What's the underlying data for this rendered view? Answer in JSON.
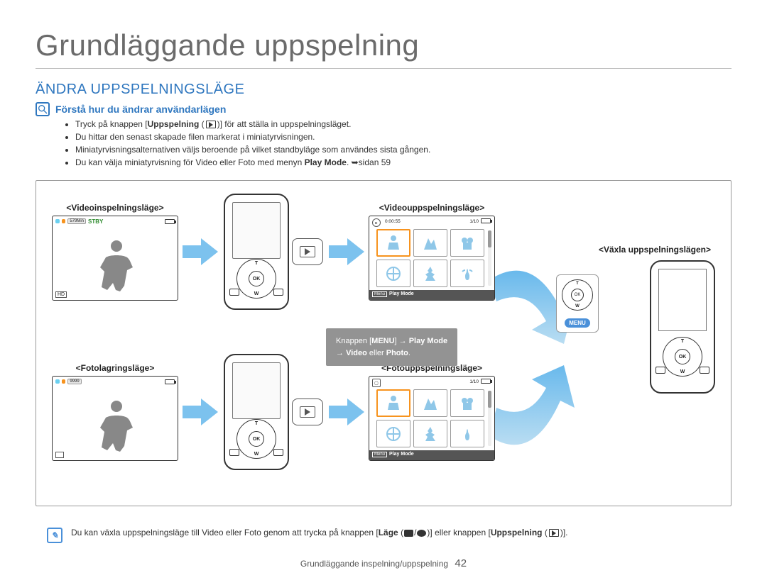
{
  "page": {
    "title": "Grundläggande uppspelning",
    "section": "ÄNDRA UPPSPELNINGSLÄGE",
    "sub_title": "Förstå hur du ändrar användarlägen",
    "bullets": [
      {
        "pre": "Tryck på knappen [",
        "bold1": "Uppspelning",
        "mid": " (",
        "icon": "play",
        "post": ")] för att ställa in uppspelningsläget."
      },
      {
        "text": "Du hittar den senast skapade filen markerat i miniatyrvisningen."
      },
      {
        "text": "Miniatyrvisningsalternativen väljs beroende på vilket standbyläge som användes sista gången."
      },
      {
        "pre": "Du kan välja miniatyrvisning för Video eller Foto med menyn ",
        "bold1": "Play Mode",
        "post": ". ➥sidan 59"
      }
    ]
  },
  "labels": {
    "video_rec": "<Videoinspelningsläge>",
    "video_play": "<Videouppspelningsläge>",
    "photo_rec": "<Fotolagringsläge>",
    "photo_play": "<Fotouppspelningsläge>",
    "switch": "<Växla uppspelningslägen>"
  },
  "lcd": {
    "rec_time": "579Min",
    "stby": "STBY",
    "hd": "HD",
    "photo_count": "9999",
    "timecode": "0:00:55",
    "index": "1/10",
    "play_mode_bar_prefix": "Menu",
    "play_mode_bar": "Play Mode"
  },
  "dpad": {
    "ok": "OK",
    "t": "T",
    "w": "W",
    "menu": "MENU"
  },
  "callout": {
    "l1a": "Knappen [",
    "l1b": "MENU",
    "l1c": "] → ",
    "l1d": "Play Mode",
    "l2a": "→ ",
    "l2b": "Video",
    "l2c": " eller ",
    "l2d": "Photo",
    "l2e": "."
  },
  "footnote": {
    "pre": "Du kan växla uppspelningsläge till Video eller Foto genom att trycka på knappen [",
    "b1": "Läge",
    "mid1": " (",
    "mid2": "/",
    "mid3": ")] eller knappen [",
    "b2": "Uppspelning",
    "mid4": " (",
    "post": ")]."
  },
  "footer": {
    "text": "Grundläggande inspelning/uppspelning",
    "page": "42"
  }
}
